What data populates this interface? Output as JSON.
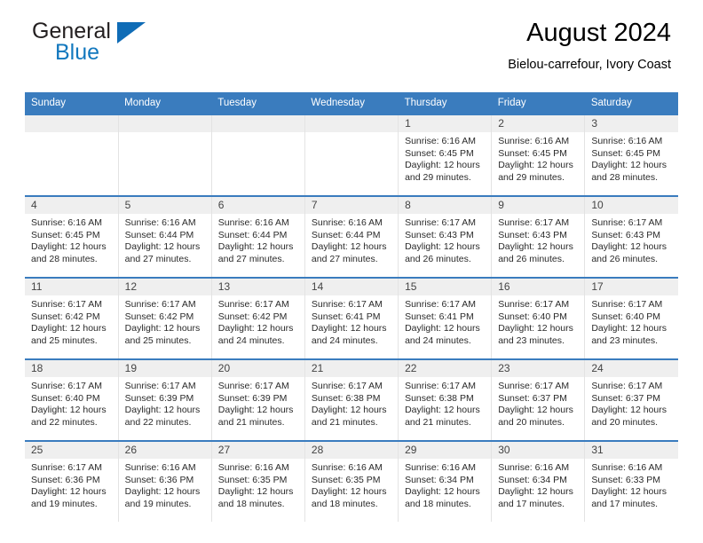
{
  "brand": {
    "name_top": "General",
    "name_bottom": "Blue",
    "accent_color": "#0f6cb6"
  },
  "header": {
    "month_title": "August 2024",
    "location": "Bielou-carrefour, Ivory Coast"
  },
  "theme": {
    "header_blue": "#3a7cbe",
    "daynum_band": "#efefef",
    "cell_divider": "#e3e3e3"
  },
  "weekday_headers": [
    "Sunday",
    "Monday",
    "Tuesday",
    "Wednesday",
    "Thursday",
    "Friday",
    "Saturday"
  ],
  "labels": {
    "sunrise_prefix": "Sunrise:",
    "sunset_prefix": "Sunset:",
    "daylight_prefix": "Daylight:"
  },
  "weeks": [
    [
      {
        "day": "",
        "empty": true
      },
      {
        "day": "",
        "empty": true
      },
      {
        "day": "",
        "empty": true
      },
      {
        "day": "",
        "empty": true
      },
      {
        "day": "1",
        "sunrise": "Sunrise: 6:16 AM",
        "sunset": "Sunset: 6:45 PM",
        "daylight_a": "Daylight: 12 hours",
        "daylight_b": "and 29 minutes."
      },
      {
        "day": "2",
        "sunrise": "Sunrise: 6:16 AM",
        "sunset": "Sunset: 6:45 PM",
        "daylight_a": "Daylight: 12 hours",
        "daylight_b": "and 29 minutes."
      },
      {
        "day": "3",
        "sunrise": "Sunrise: 6:16 AM",
        "sunset": "Sunset: 6:45 PM",
        "daylight_a": "Daylight: 12 hours",
        "daylight_b": "and 28 minutes."
      }
    ],
    [
      {
        "day": "4",
        "sunrise": "Sunrise: 6:16 AM",
        "sunset": "Sunset: 6:45 PM",
        "daylight_a": "Daylight: 12 hours",
        "daylight_b": "and 28 minutes."
      },
      {
        "day": "5",
        "sunrise": "Sunrise: 6:16 AM",
        "sunset": "Sunset: 6:44 PM",
        "daylight_a": "Daylight: 12 hours",
        "daylight_b": "and 27 minutes."
      },
      {
        "day": "6",
        "sunrise": "Sunrise: 6:16 AM",
        "sunset": "Sunset: 6:44 PM",
        "daylight_a": "Daylight: 12 hours",
        "daylight_b": "and 27 minutes."
      },
      {
        "day": "7",
        "sunrise": "Sunrise: 6:16 AM",
        "sunset": "Sunset: 6:44 PM",
        "daylight_a": "Daylight: 12 hours",
        "daylight_b": "and 27 minutes."
      },
      {
        "day": "8",
        "sunrise": "Sunrise: 6:17 AM",
        "sunset": "Sunset: 6:43 PM",
        "daylight_a": "Daylight: 12 hours",
        "daylight_b": "and 26 minutes."
      },
      {
        "day": "9",
        "sunrise": "Sunrise: 6:17 AM",
        "sunset": "Sunset: 6:43 PM",
        "daylight_a": "Daylight: 12 hours",
        "daylight_b": "and 26 minutes."
      },
      {
        "day": "10",
        "sunrise": "Sunrise: 6:17 AM",
        "sunset": "Sunset: 6:43 PM",
        "daylight_a": "Daylight: 12 hours",
        "daylight_b": "and 26 minutes."
      }
    ],
    [
      {
        "day": "11",
        "sunrise": "Sunrise: 6:17 AM",
        "sunset": "Sunset: 6:42 PM",
        "daylight_a": "Daylight: 12 hours",
        "daylight_b": "and 25 minutes."
      },
      {
        "day": "12",
        "sunrise": "Sunrise: 6:17 AM",
        "sunset": "Sunset: 6:42 PM",
        "daylight_a": "Daylight: 12 hours",
        "daylight_b": "and 25 minutes."
      },
      {
        "day": "13",
        "sunrise": "Sunrise: 6:17 AM",
        "sunset": "Sunset: 6:42 PM",
        "daylight_a": "Daylight: 12 hours",
        "daylight_b": "and 24 minutes."
      },
      {
        "day": "14",
        "sunrise": "Sunrise: 6:17 AM",
        "sunset": "Sunset: 6:41 PM",
        "daylight_a": "Daylight: 12 hours",
        "daylight_b": "and 24 minutes."
      },
      {
        "day": "15",
        "sunrise": "Sunrise: 6:17 AM",
        "sunset": "Sunset: 6:41 PM",
        "daylight_a": "Daylight: 12 hours",
        "daylight_b": "and 24 minutes."
      },
      {
        "day": "16",
        "sunrise": "Sunrise: 6:17 AM",
        "sunset": "Sunset: 6:40 PM",
        "daylight_a": "Daylight: 12 hours",
        "daylight_b": "and 23 minutes."
      },
      {
        "day": "17",
        "sunrise": "Sunrise: 6:17 AM",
        "sunset": "Sunset: 6:40 PM",
        "daylight_a": "Daylight: 12 hours",
        "daylight_b": "and 23 minutes."
      }
    ],
    [
      {
        "day": "18",
        "sunrise": "Sunrise: 6:17 AM",
        "sunset": "Sunset: 6:40 PM",
        "daylight_a": "Daylight: 12 hours",
        "daylight_b": "and 22 minutes."
      },
      {
        "day": "19",
        "sunrise": "Sunrise: 6:17 AM",
        "sunset": "Sunset: 6:39 PM",
        "daylight_a": "Daylight: 12 hours",
        "daylight_b": "and 22 minutes."
      },
      {
        "day": "20",
        "sunrise": "Sunrise: 6:17 AM",
        "sunset": "Sunset: 6:39 PM",
        "daylight_a": "Daylight: 12 hours",
        "daylight_b": "and 21 minutes."
      },
      {
        "day": "21",
        "sunrise": "Sunrise: 6:17 AM",
        "sunset": "Sunset: 6:38 PM",
        "daylight_a": "Daylight: 12 hours",
        "daylight_b": "and 21 minutes."
      },
      {
        "day": "22",
        "sunrise": "Sunrise: 6:17 AM",
        "sunset": "Sunset: 6:38 PM",
        "daylight_a": "Daylight: 12 hours",
        "daylight_b": "and 21 minutes."
      },
      {
        "day": "23",
        "sunrise": "Sunrise: 6:17 AM",
        "sunset": "Sunset: 6:37 PM",
        "daylight_a": "Daylight: 12 hours",
        "daylight_b": "and 20 minutes."
      },
      {
        "day": "24",
        "sunrise": "Sunrise: 6:17 AM",
        "sunset": "Sunset: 6:37 PM",
        "daylight_a": "Daylight: 12 hours",
        "daylight_b": "and 20 minutes."
      }
    ],
    [
      {
        "day": "25",
        "sunrise": "Sunrise: 6:17 AM",
        "sunset": "Sunset: 6:36 PM",
        "daylight_a": "Daylight: 12 hours",
        "daylight_b": "and 19 minutes."
      },
      {
        "day": "26",
        "sunrise": "Sunrise: 6:16 AM",
        "sunset": "Sunset: 6:36 PM",
        "daylight_a": "Daylight: 12 hours",
        "daylight_b": "and 19 minutes."
      },
      {
        "day": "27",
        "sunrise": "Sunrise: 6:16 AM",
        "sunset": "Sunset: 6:35 PM",
        "daylight_a": "Daylight: 12 hours",
        "daylight_b": "and 18 minutes."
      },
      {
        "day": "28",
        "sunrise": "Sunrise: 6:16 AM",
        "sunset": "Sunset: 6:35 PM",
        "daylight_a": "Daylight: 12 hours",
        "daylight_b": "and 18 minutes."
      },
      {
        "day": "29",
        "sunrise": "Sunrise: 6:16 AM",
        "sunset": "Sunset: 6:34 PM",
        "daylight_a": "Daylight: 12 hours",
        "daylight_b": "and 18 minutes."
      },
      {
        "day": "30",
        "sunrise": "Sunrise: 6:16 AM",
        "sunset": "Sunset: 6:34 PM",
        "daylight_a": "Daylight: 12 hours",
        "daylight_b": "and 17 minutes."
      },
      {
        "day": "31",
        "sunrise": "Sunrise: 6:16 AM",
        "sunset": "Sunset: 6:33 PM",
        "daylight_a": "Daylight: 12 hours",
        "daylight_b": "and 17 minutes."
      }
    ]
  ]
}
